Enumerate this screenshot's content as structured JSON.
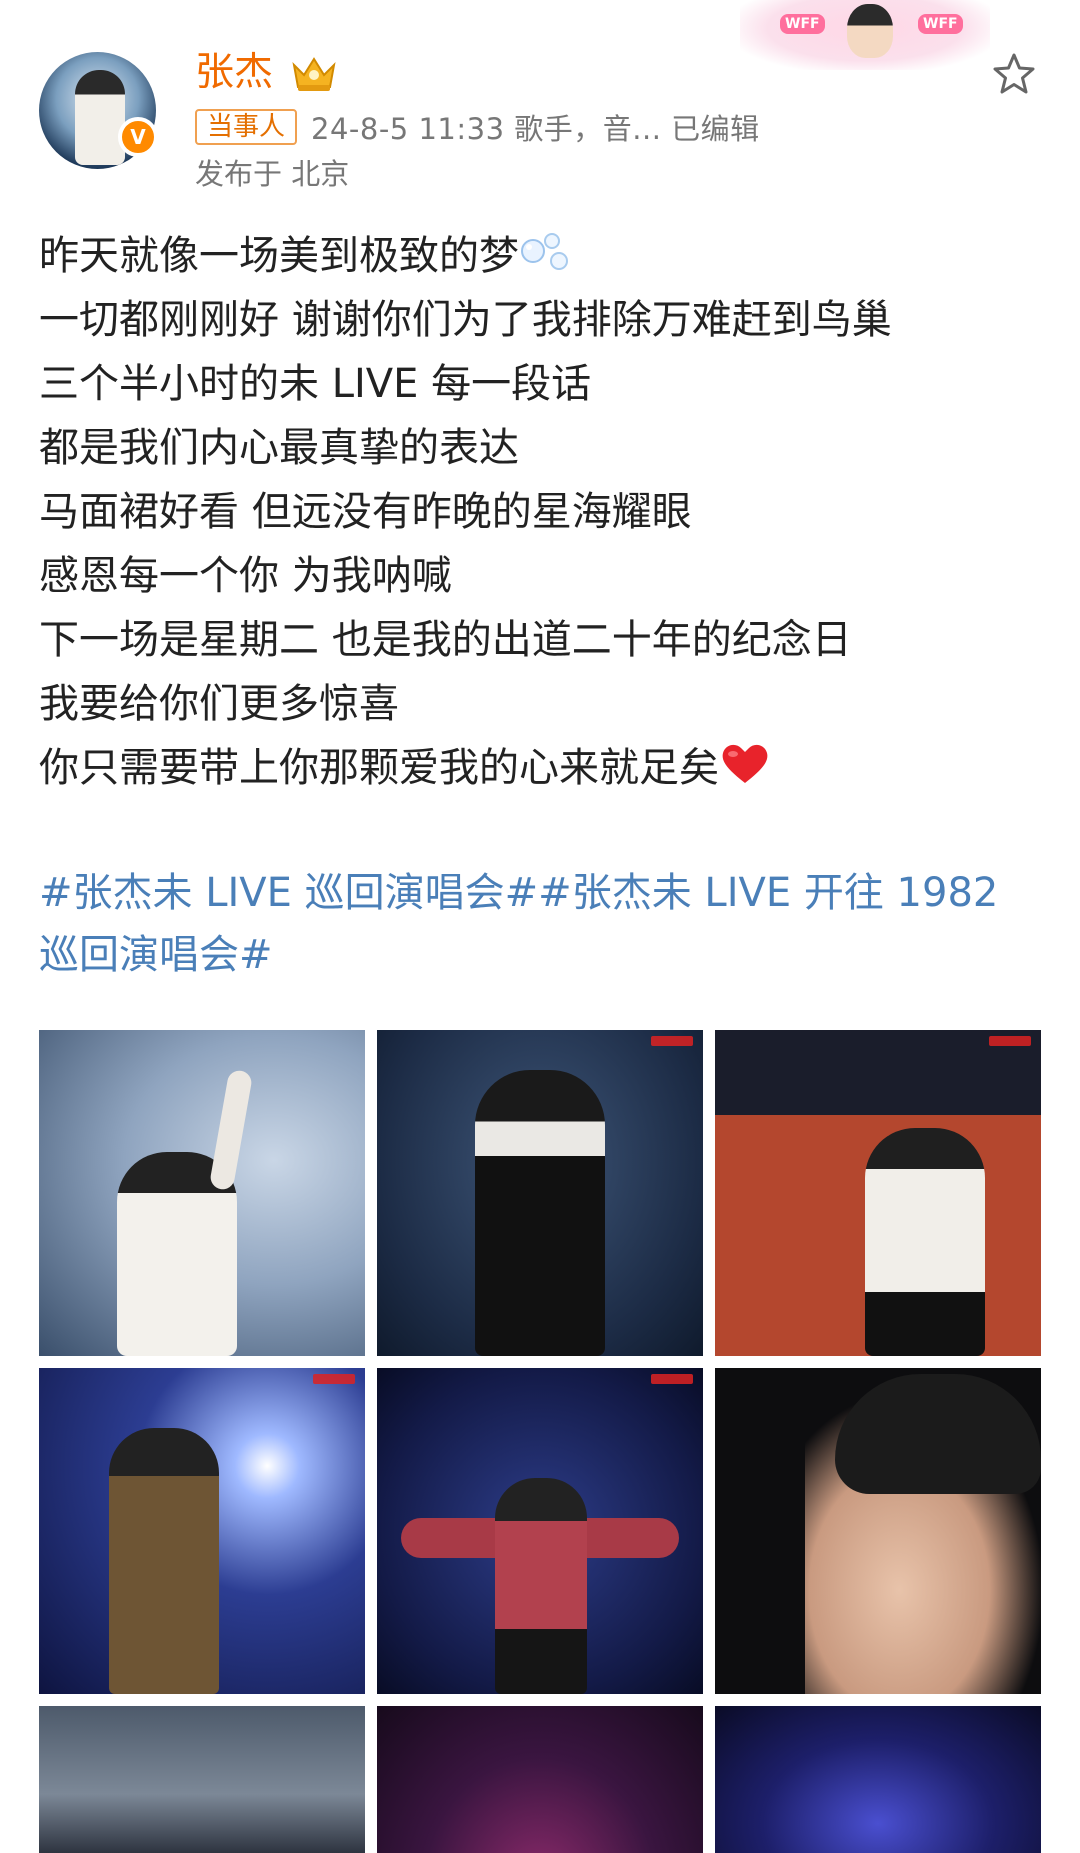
{
  "post": {
    "username": "张杰",
    "badge": "当事人",
    "meta": "24-8-5 11:33  歌手，音...  已编辑",
    "location": "发布于 北京",
    "lines": [
      "昨天就像一场美到极致的梦",
      "一切都刚刚好 谢谢你们为了我排除万难赶到鸟巢",
      "三个半小时的未 LIVE 每一段话",
      "都是我们内心最真挚的表达",
      "马面裙好看 但远没有昨晚的星海耀眼",
      "感恩每一个你 为我呐喊",
      "下一场是星期二 也是我的出道二十年的纪念日",
      "我要给你们更多惊喜",
      "你只需要带上你那颗爱我的心来就足矣"
    ],
    "hashtag_line1": "#张杰未 LIVE 巡回演唱会##张杰未 LIVE 开往 1982",
    "hashtag_line2": "巡回演唱会#",
    "verify_mark": "V"
  },
  "banner": {
    "tag_left": "WFF",
    "tag_right": "WFF"
  },
  "icons": {
    "avatar": "avatar",
    "verified": "verified-icon",
    "crown": "crown-icon",
    "star": "star-icon",
    "bubbles": "bubbles-emoji",
    "heart": "heart-emoji"
  },
  "colors": {
    "username": "#f06a00",
    "hashtag": "#4a7fb8",
    "meta": "#777777",
    "badge_border": "#f0a050"
  },
  "photos": [
    {
      "name": "photo-wave-closeup"
    },
    {
      "name": "photo-sequin-jacket"
    },
    {
      "name": "photo-pointing-stage"
    },
    {
      "name": "photo-brown-coat-stadium"
    },
    {
      "name": "photo-red-shirt-arms-open"
    },
    {
      "name": "photo-face-closeup"
    },
    {
      "name": "photo-cloudy-sky"
    },
    {
      "name": "photo-stage-roof"
    },
    {
      "name": "photo-crowd-lights"
    }
  ]
}
